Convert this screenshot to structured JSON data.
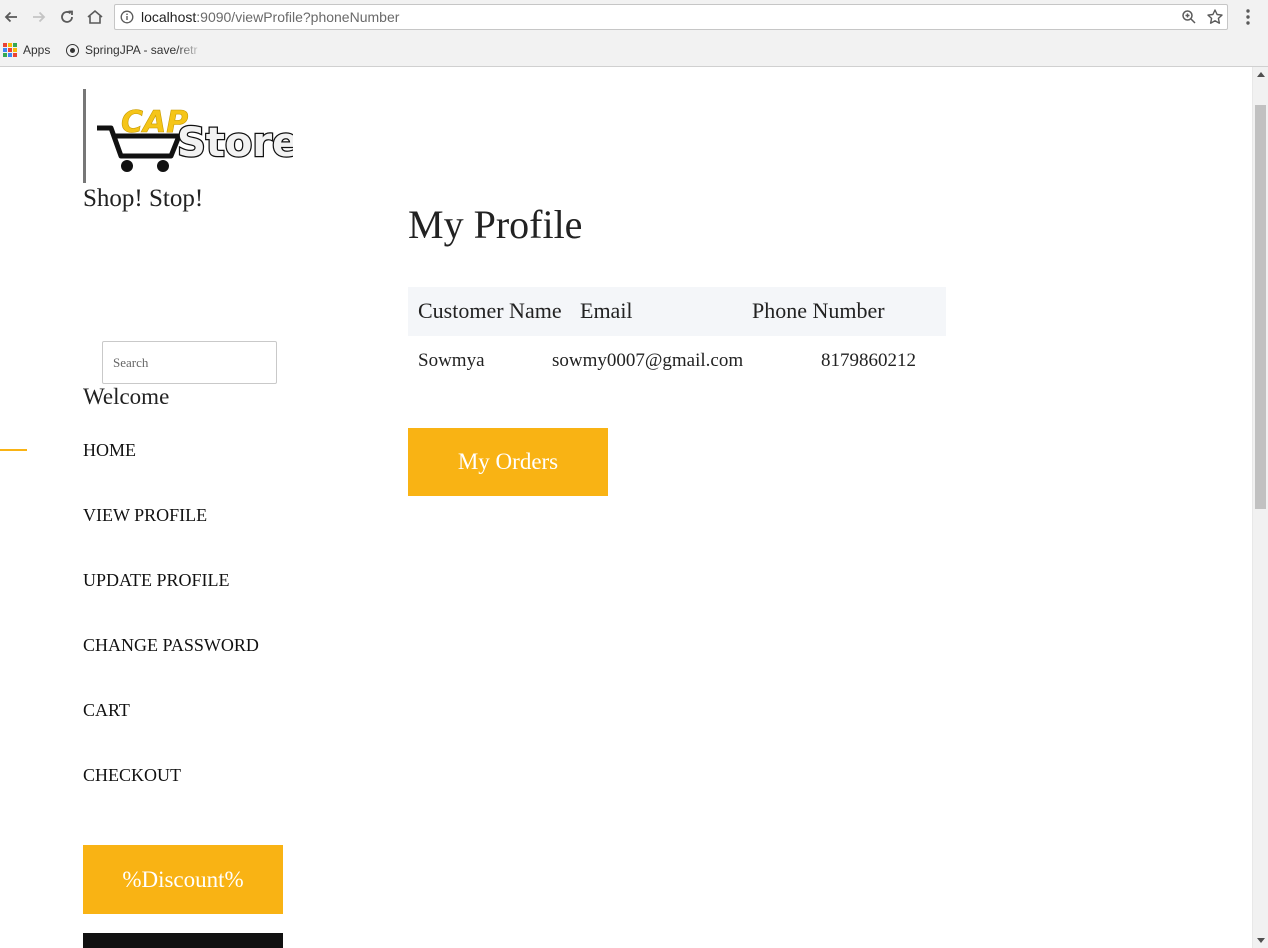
{
  "browser": {
    "url_host": "localhost",
    "url_rest": ":9090/viewProfile?phoneNumber",
    "bookmarks": [
      {
        "label": "Apps"
      },
      {
        "label": "SpringJPA - save/retr"
      }
    ]
  },
  "sidebar": {
    "logo_text_top": "CAP",
    "logo_text_main": "Store",
    "tagline": "Shop! Stop!",
    "search_placeholder": "Search",
    "welcome": "Welcome",
    "nav": [
      {
        "label": "HOME"
      },
      {
        "label": "VIEW PROFILE"
      },
      {
        "label": "UPDATE PROFILE"
      },
      {
        "label": "CHANGE PASSWORD"
      },
      {
        "label": "CART"
      },
      {
        "label": "CHECKOUT"
      }
    ],
    "discount_button": "%Discount%"
  },
  "main": {
    "title": "My Profile",
    "table": {
      "headers": [
        "Customer Name",
        "Email",
        "Phone Number"
      ],
      "rows": [
        [
          "Sowmya",
          "sowmy0007@gmail.com",
          "8179860212"
        ]
      ]
    },
    "orders_button": "My Orders"
  },
  "colors": {
    "accent": "#f9b314",
    "header_row_bg": "#f4f6f9",
    "text": "#222222"
  }
}
